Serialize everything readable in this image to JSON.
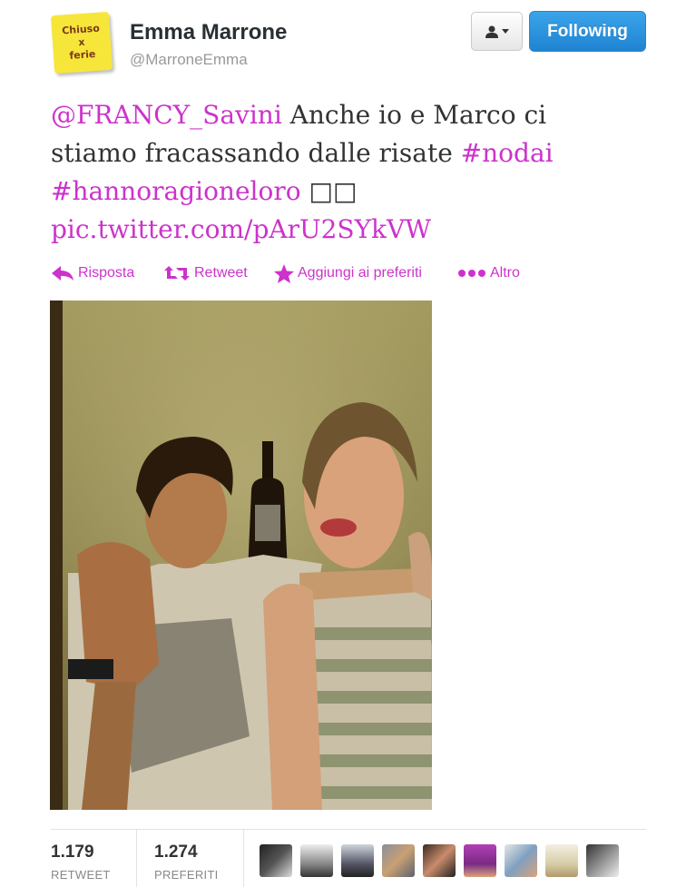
{
  "user": {
    "avatar_text": "Chiuso\nx\nferie",
    "full_name": "Emma Marrone",
    "screen_name": "@MarroneEmma",
    "follow_label": "Following"
  },
  "tweet": {
    "mention": "@FRANCY_Savini",
    "text1": " Anche io e Marco ci stiamo fracassando dalle risate ",
    "hashtag1": "#nodai",
    "space": " ",
    "hashtag2": "#hannoragioneloro",
    "boxes": " □□",
    "pic_link": "pic.twitter.com/pArU2SYkVW"
  },
  "actions": {
    "reply": "Risposta",
    "retweet": "Retweet",
    "favorite": "Aggiungi ai preferiti",
    "more": "Altro"
  },
  "stats": {
    "retweets_value": "1.179",
    "retweets_label": "RETWEET",
    "favorites_value": "1.274",
    "favorites_label": "PREFERITI"
  },
  "colors": {
    "link": "#cc33cc",
    "follow_button": "#2a8fe0"
  },
  "icons": {
    "reply": "reply-arrow-icon",
    "retweet": "retweet-icon",
    "favorite": "star-icon",
    "more": "dots-icon",
    "user_menu": "person-icon"
  }
}
